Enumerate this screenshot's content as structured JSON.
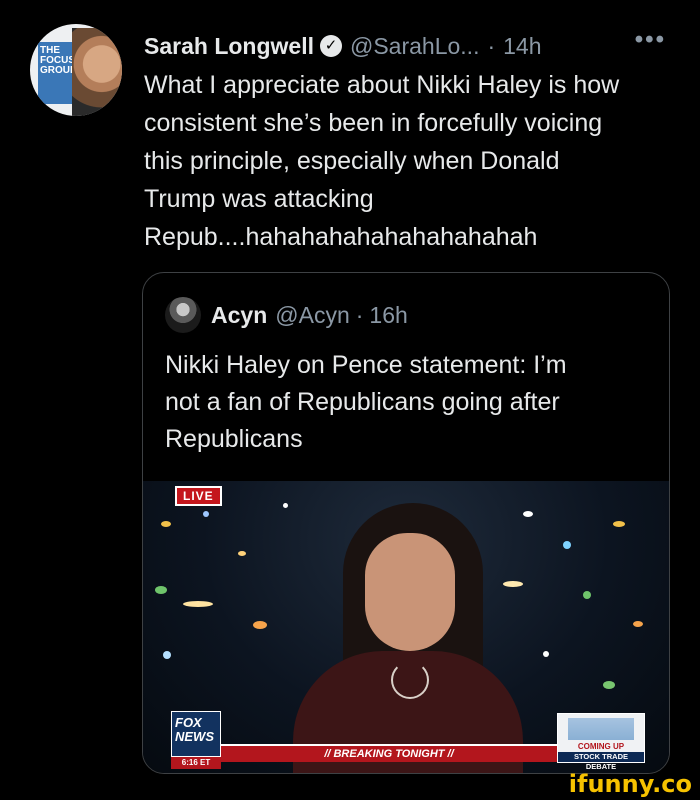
{
  "tweet": {
    "author_name": "Sarah Longwell",
    "handle": "@SarahLo...",
    "separator": "·",
    "time": "14h",
    "more": "•••",
    "text": "What I appreciate about Nikki Haley is how\nconsistent she’s been in forcefully voicing\nthis principle, especially when Donald\nTrump was attacking\nRepub....hahahahahahahahahahah",
    "avatar_book_text": "THE\nFOCUS\nGROUP"
  },
  "quote": {
    "author_name": "Acyn",
    "handle": "@Acyn",
    "separator": "·",
    "time": "16h",
    "text": "Nikki Haley on Pence statement: I’m\nnot a fan of Republicans going after\nRepublicans",
    "video": {
      "live_label": "LIVE",
      "network_label": "FOX\nNEWS",
      "chyron": "// BREAKING TONIGHT //",
      "coming_up_label": "COMING UP",
      "coming_up_title": "STOCK TRADE DEBATE",
      "time_tag": "6:16 ET"
    }
  },
  "watermark": "ifunny.co",
  "colors": {
    "background": "#000000",
    "primary_text": "#e7e9ea",
    "secondary_text": "#8b98a5",
    "border": "#3e4144",
    "fox_red": "#b3161d",
    "watermark": "#f6c200"
  }
}
